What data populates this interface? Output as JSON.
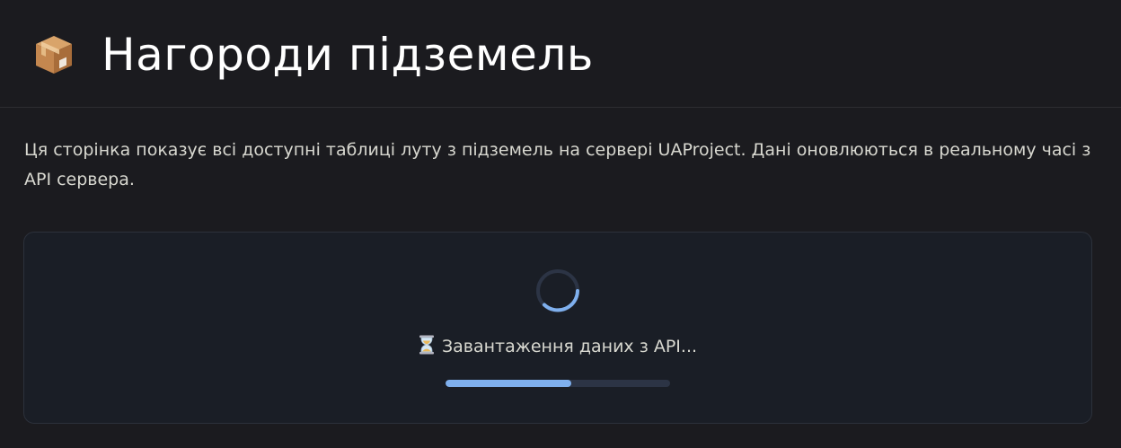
{
  "page": {
    "title": "Нагороди підземель",
    "title_icon": "package-box-icon",
    "description": "Ця сторінка показує всі доступні таблиці луту з підземель на сервері UAProject. Дані оновлюються в реальному часі з API сервера."
  },
  "loading": {
    "status_icon": "hourglass-icon",
    "status_text": "Завантаження даних з API...",
    "progress": 0.56
  },
  "colors": {
    "background": "#1b1b1f",
    "card_background": "#1a1e26",
    "accent": "#7fb0ee",
    "progress_track": "#2c3445"
  }
}
